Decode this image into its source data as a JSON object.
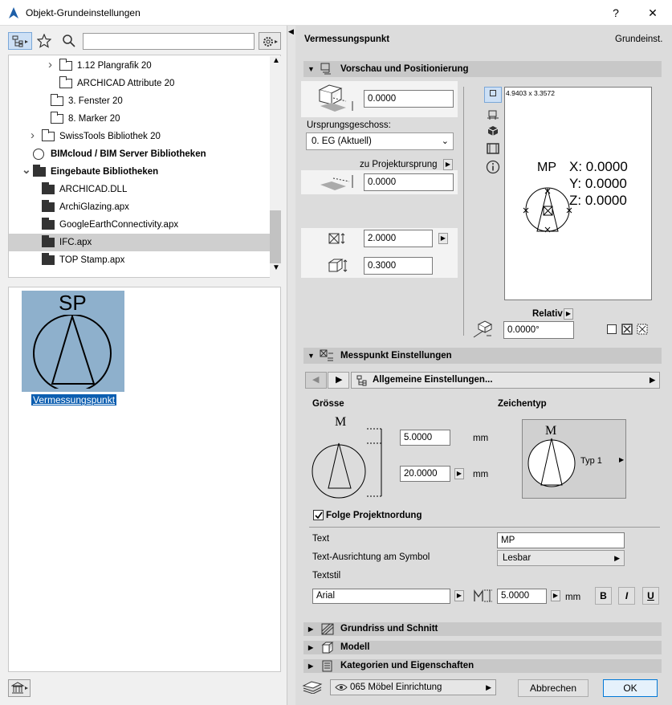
{
  "window": {
    "title": "Objekt-Grundeinstellungen",
    "help": "?",
    "close": "✕"
  },
  "search": {
    "value": "",
    "placeholder": ""
  },
  "tree": [
    {
      "label": "1.12 Plangrafik 20",
      "indent": 1,
      "chevron": ">",
      "dark": false,
      "bold": false,
      "selected": false
    },
    {
      "label": "ARCHICAD Attribute 20",
      "indent": 1,
      "chevron": "",
      "dark": false,
      "bold": false,
      "selected": false
    },
    {
      "label": "3. Fenster 20",
      "indent": 0,
      "chevron": "",
      "dark": false,
      "bold": false,
      "selected": false
    },
    {
      "label": "8. Marker 20",
      "indent": 0,
      "chevron": "",
      "dark": false,
      "bold": false,
      "selected": false
    },
    {
      "label": "SwissTools Bibliothek 20",
      "indent": -1,
      "chevron": ">",
      "dark": false,
      "bold": false,
      "selected": false
    },
    {
      "label": "BIMcloud / BIM Server Bibliotheken",
      "indent": -2,
      "chevron": "",
      "dark": false,
      "bold": true,
      "selected": false
    },
    {
      "label": "Eingebaute Bibliotheken",
      "indent": -2,
      "chevron": "v",
      "dark": true,
      "bold": true,
      "selected": false
    },
    {
      "label": "ARCHICAD.DLL",
      "indent": -1,
      "chevron": "",
      "dark": true,
      "bold": false,
      "selected": false
    },
    {
      "label": "ArchiGlazing.apx",
      "indent": -1,
      "chevron": "",
      "dark": true,
      "bold": false,
      "selected": false
    },
    {
      "label": "GoogleEarthConnectivity.apx",
      "indent": -1,
      "chevron": "",
      "dark": true,
      "bold": false,
      "selected": false
    },
    {
      "label": "IFC.apx",
      "indent": -1,
      "chevron": "",
      "dark": true,
      "bold": false,
      "selected": true
    },
    {
      "label": "TOP Stamp.apx",
      "indent": -1,
      "chevron": "",
      "dark": true,
      "bold": false,
      "selected": false
    }
  ],
  "preview": {
    "symbol": "SP",
    "name": "Vermessungspunkt"
  },
  "header": {
    "object": "Vermessungspunkt",
    "right": "Grundeinst."
  },
  "sections": {
    "s1": "Vorschau und Positionierung",
    "s2": "Messpunkt Einstellungen",
    "s3": "Grundriss und Schnitt",
    "s4": "Modell",
    "s5": "Kategorien und Eigenschaften"
  },
  "positioning": {
    "elev1": "0.0000",
    "ursprung_label": "Ursprungsgeschoss:",
    "ursprung_value": "0. EG (Aktuell)",
    "zu_label": "zu Projektursprung",
    "elev2": "0.0000",
    "width": "2.0000",
    "height": "0.3000",
    "size_readout": "4.9403 x 3.3572",
    "mp": "MP",
    "x": "X: 0.0000",
    "y": "Y: 0.0000",
    "z": "Z: 0.0000",
    "relativ": "Relativ",
    "angle": "0.0000°"
  },
  "messpunkt": {
    "page": "Allgemeine Einstellungen...",
    "groesse": "Grösse",
    "zeichentyp": "Zeichentyp",
    "m": "M",
    "size1": "5.0000",
    "size2": "20.0000",
    "unit1": "mm",
    "unit2": "mm",
    "typ": "Typ 1",
    "folge": "Folge Projektnordung",
    "text_label": "Text",
    "text_value": "MP",
    "ausr_label": "Text-Ausrichtung am Symbol",
    "ausr_value": "Lesbar",
    "textstil_label": "Textstil",
    "font_value": "Arial",
    "font_size": "5.0000",
    "font_unit": "mm",
    "b": "B",
    "i": "I",
    "u": "U"
  },
  "footer": {
    "layer": "065 Möbel Einrichtung",
    "cancel": "Abbrechen",
    "ok": "OK"
  }
}
